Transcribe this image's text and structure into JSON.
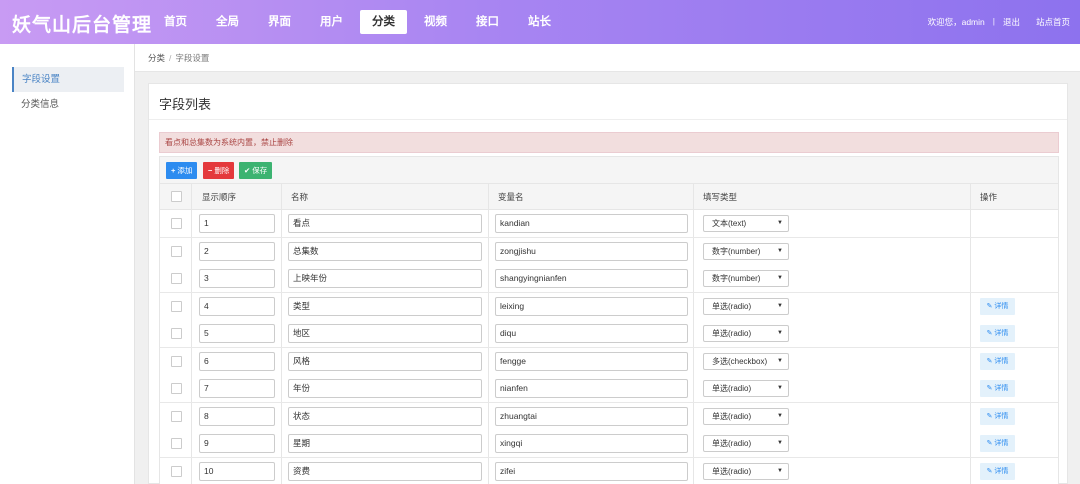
{
  "header": {
    "logo": "妖气山后台管理",
    "nav": [
      "首页",
      "全局",
      "界面",
      "用户",
      "分类",
      "视频",
      "接口",
      "站长"
    ],
    "active_nav": "分类",
    "welcome": "欢迎您，admin",
    "divider": "|",
    "logout": "退出",
    "site_home": "站点首页"
  },
  "sidebar": {
    "items": [
      {
        "label": "字段设置",
        "active": true
      },
      {
        "label": "分类信息",
        "active": false
      }
    ]
  },
  "breadcrumb": {
    "root": "分类",
    "sep": "/",
    "current": "字段设置"
  },
  "panel": {
    "title": "字段列表",
    "alert": "看点和总集数为系统内置，禁止删除",
    "buttons": {
      "add": "添加",
      "delete": "删除",
      "save": "保存"
    },
    "columns": [
      "显示顺序",
      "名称",
      "变量名",
      "填写类型",
      "操作"
    ],
    "rows": [
      {
        "order": "1",
        "name": "看点",
        "var": "kandian",
        "type": "文本(text)",
        "action": ""
      },
      {
        "order": "2",
        "name": "总集数",
        "var": "zongjishu",
        "type": "数字(number)",
        "action": ""
      },
      {
        "order": "3",
        "name": "上映年份",
        "var": "shangyingnianfen",
        "type": "数字(number)",
        "action": ""
      },
      {
        "order": "4",
        "name": "类型",
        "var": "leixing",
        "type": "单选(radio)",
        "action": "详情"
      },
      {
        "order": "5",
        "name": "地区",
        "var": "diqu",
        "type": "单选(radio)",
        "action": "详情"
      },
      {
        "order": "6",
        "name": "风格",
        "var": "fengge",
        "type": "多选(checkbox)",
        "action": "详情"
      },
      {
        "order": "7",
        "name": "年份",
        "var": "nianfen",
        "type": "单选(radio)",
        "action": "详情"
      },
      {
        "order": "8",
        "name": "状态",
        "var": "zhuangtai",
        "type": "单选(radio)",
        "action": "详情"
      },
      {
        "order": "9",
        "name": "星期",
        "var": "xingqi",
        "type": "单选(radio)",
        "action": "详情"
      },
      {
        "order": "10",
        "name": "资费",
        "var": "zifei",
        "type": "单选(radio)",
        "action": "详情"
      }
    ]
  },
  "icons": {
    "add": "plus-icon",
    "delete": "minus-icon",
    "save": "check-icon",
    "detail": "pencil-icon",
    "select": "caret-down-icon"
  },
  "colors": {
    "header_start": "#c89bf3",
    "header_end": "#8d72ee",
    "add": "#2d8cf0",
    "delete": "#e4393c",
    "save": "#3cb371",
    "alert_bg": "#f2dede",
    "alert_text": "#a94442"
  }
}
